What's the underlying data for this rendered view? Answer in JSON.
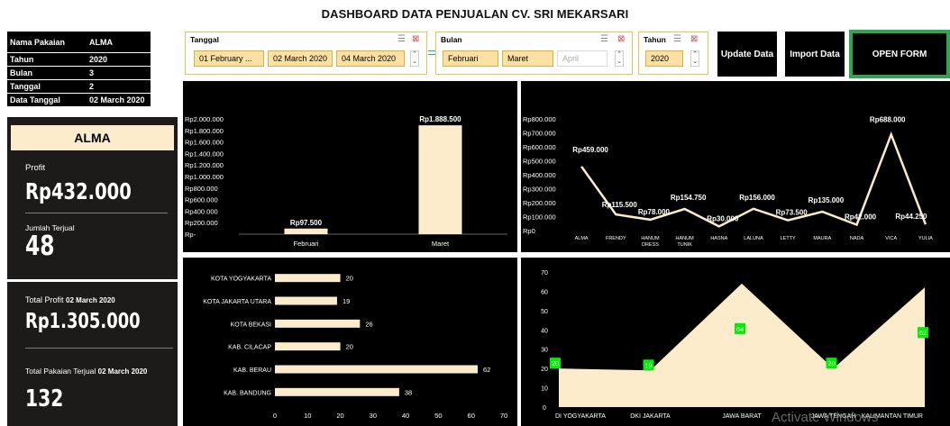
{
  "title": "DASHBOARD DATA PENJUALAN CV. SRI MEKARSARI",
  "info": {
    "rows": [
      {
        "key": "Nama Pakaian",
        "value": "ALMA"
      },
      {
        "key": "Tahun",
        "value": "2020"
      },
      {
        "key": "Bulan",
        "value": "3"
      },
      {
        "key": "Tanggal",
        "value": "2"
      },
      {
        "key": "Data Tanggal",
        "value": "02 March 2020"
      }
    ]
  },
  "product_panel": {
    "name": "ALMA",
    "profit_label": "Profit",
    "profit_value": "Rp432.000",
    "sold_label": "Jumlah Terjual",
    "sold_value": "48"
  },
  "totals_panel": {
    "total_profit_label": "Total Profit",
    "total_profit_date": "02 March 2020",
    "total_profit_value": "Rp1.305.000",
    "total_sold_label": "Total Pakaian Terjual",
    "total_sold_date": "02 March 2020",
    "total_sold_value": "132"
  },
  "slicers": {
    "tanggal": {
      "header": "Tanggal",
      "items": [
        "01 February ...",
        "02 March 2020",
        "04 March 2020"
      ]
    },
    "bulan": {
      "header": "Bulan",
      "items": [
        "Februari",
        "Maret",
        "April"
      ]
    },
    "tahun": {
      "header": "Tahun",
      "items": [
        "2020"
      ]
    }
  },
  "buttons": {
    "update": "Update Data",
    "import": "Import Data",
    "open_form": "OPEN FORM"
  },
  "watermark": "Activate Windows",
  "chart_data": [
    {
      "type": "bar",
      "categories": [
        "Februari",
        "Maret"
      ],
      "values": [
        97500,
        1888500
      ],
      "data_labels": [
        "Rp97.500",
        "Rp1.888.500"
      ],
      "ylim": [
        0,
        2000000
      ],
      "yticks": [
        "Rp-",
        "Rp200.000",
        "Rp400.000",
        "Rp600.000",
        "Rp800.000",
        "Rp1.000.000",
        "Rp1.200.000",
        "Rp1.400.000",
        "Rp1.600.000",
        "Rp1.800.000",
        "Rp2.000.000"
      ],
      "bar_color": "#fdeccc"
    },
    {
      "type": "line",
      "categories": [
        "ALMA",
        "FRENDY",
        "HANUM DRESS",
        "HANUM TUNIK",
        "HASNA",
        "LALUNA",
        "LETTY",
        "MAURA",
        "NADA",
        "VICA",
        "YULIA"
      ],
      "values": [
        459000,
        115500,
        78000,
        154750,
        30000,
        156000,
        73500,
        135000,
        42000,
        688000,
        44250
      ],
      "data_labels": [
        "Rp459.000",
        "Rp115.500",
        "Rp78.000",
        "Rp154.750",
        "Rp30.000",
        "Rp156.000",
        "Rp73.500",
        "Rp135.000",
        "Rp42.000",
        "Rp688.000",
        "Rp44.250"
      ],
      "ylim": [
        0,
        800000
      ],
      "yticks": [
        "Rp0",
        "Rp100.000",
        "Rp200.000",
        "Rp300.000",
        "Rp400.000",
        "Rp500.000",
        "Rp600.000",
        "Rp700.000",
        "Rp800.000"
      ],
      "line_color": "#fdeccc"
    },
    {
      "type": "bar",
      "orientation": "horizontal",
      "categories": [
        "KOTA YOGYAKARTA",
        "KOTA JAKARTA UTARA",
        "KOTA BEKASI",
        "KAB. CILACAP",
        "KAB. BERAU",
        "KAB. BANDUNG"
      ],
      "values": [
        20,
        19,
        26,
        20,
        62,
        38
      ],
      "xlim": [
        0,
        70
      ],
      "xticks": [
        "0",
        "10",
        "20",
        "30",
        "40",
        "50",
        "60",
        "70"
      ],
      "bar_color": "#fdeccc"
    },
    {
      "type": "area",
      "categories": [
        "DI YOGYAKARTA",
        "DKI JAKARTA",
        "JAWA BARAT",
        "JAWA TENGAH",
        "KALIMANTAN TIMUR"
      ],
      "values": [
        20,
        19,
        64,
        20,
        62
      ],
      "ylim": [
        0,
        70
      ],
      "yticks": [
        "0",
        "10",
        "20",
        "30",
        "40",
        "50",
        "60",
        "70"
      ],
      "fill_color": "#fdeccc",
      "label_color": "#00ee00"
    }
  ]
}
